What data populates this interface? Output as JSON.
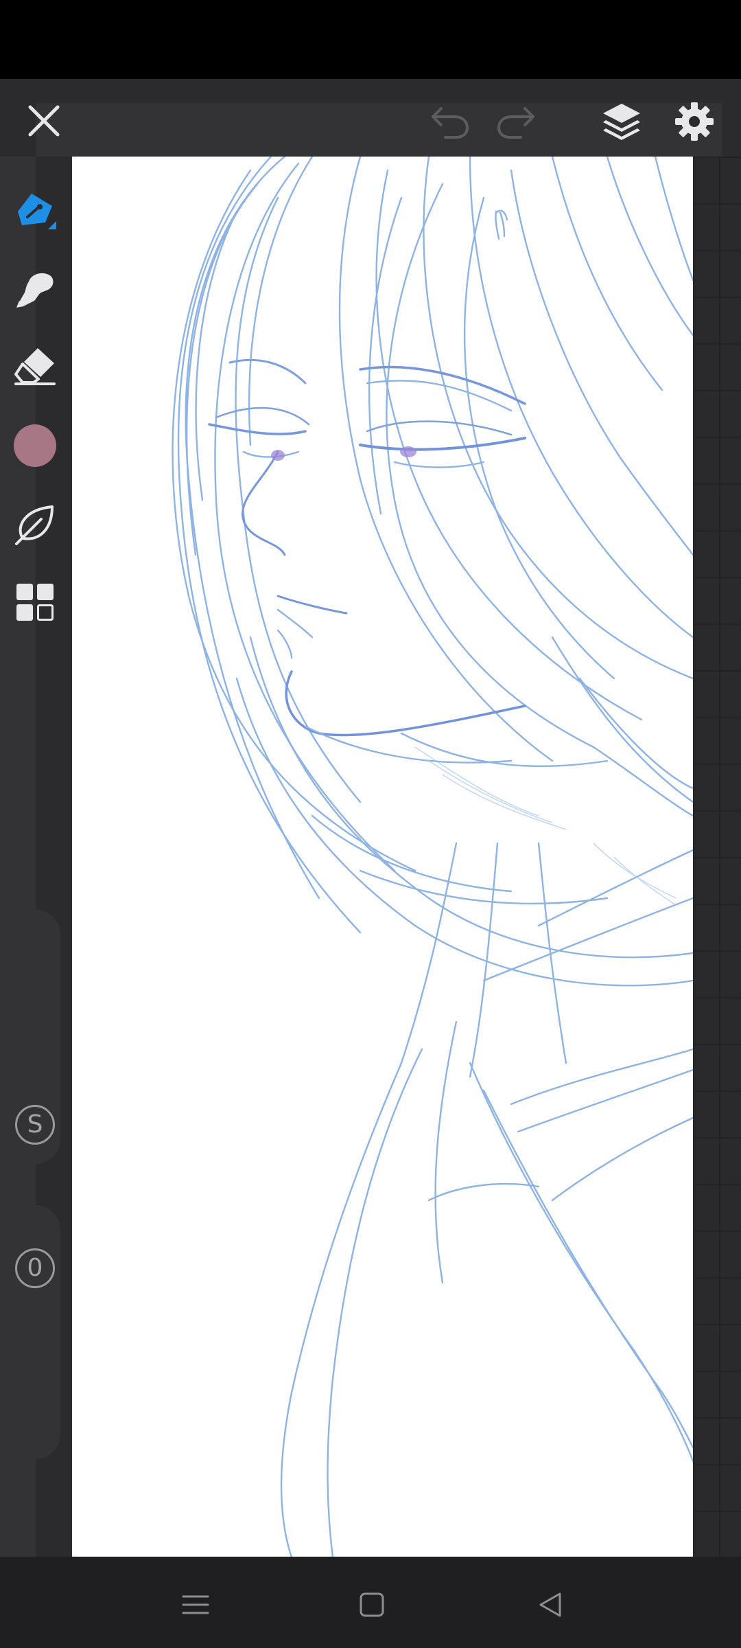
{
  "app": {
    "screen": "drawing-canvas",
    "accent_color": "#1e8fe6",
    "background_color": "#2b2b2d",
    "canvas_color": "#ffffff",
    "sketch_line_color": "#6a9be0"
  },
  "top_bar": {
    "icons": [
      "close-icon",
      "undo-icon",
      "redo-icon",
      "layers-icon",
      "settings-icon"
    ],
    "undo_enabled": false,
    "redo_enabled": false
  },
  "toolbar": {
    "tools": [
      "pen-tool-icon",
      "smudge-tool-icon",
      "eraser-tool-icon",
      "color-picker",
      "lasso-leaf-icon",
      "grid-menu-icon"
    ],
    "active_tool": "pen",
    "current_color": "#a87786"
  },
  "side_controls": {
    "size_label": "S",
    "opacity_label": "0"
  },
  "nav_bar": {
    "icons": [
      "menu-icon",
      "home-icon",
      "back-icon"
    ]
  }
}
